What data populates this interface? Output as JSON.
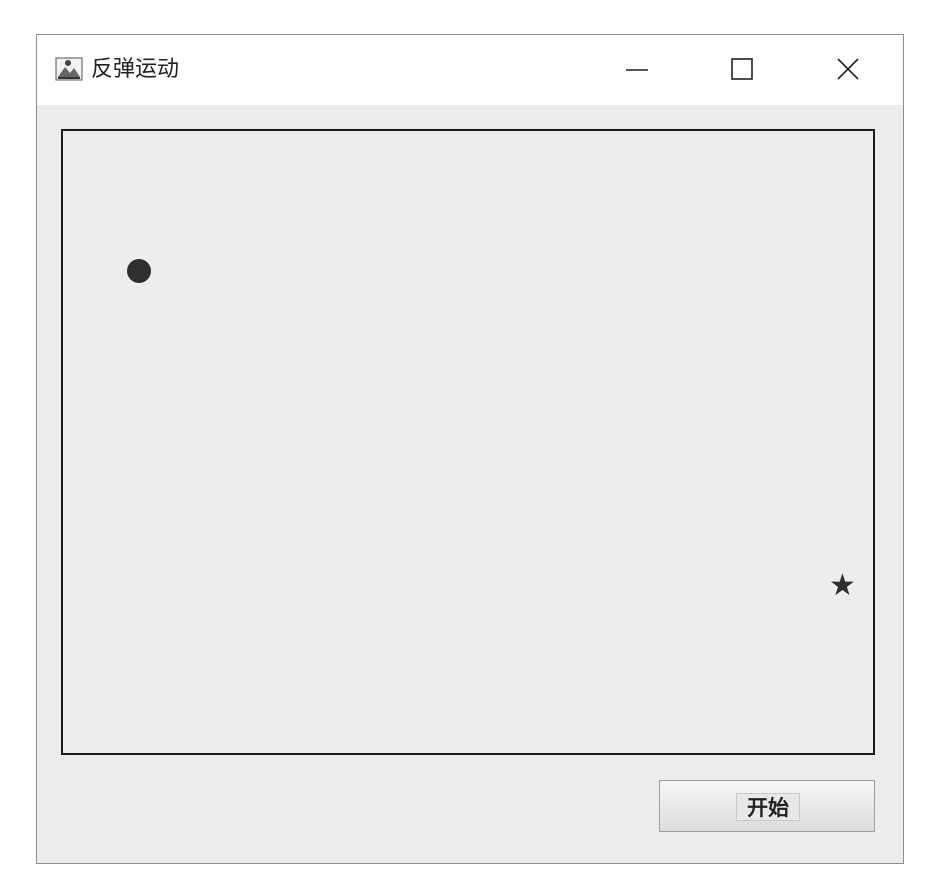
{
  "window": {
    "title": "反弹运动",
    "app_icon": "java-app-icon",
    "controls": [
      "minimize-icon",
      "maximize-icon",
      "close-icon"
    ]
  },
  "canvas": {
    "ball": "ball-icon",
    "star_glyph": "★"
  },
  "footer": {
    "start_label": "开始"
  },
  "colors": {
    "window_bg": "#ececec",
    "titlebar_bg": "#ffffff",
    "canvas_border": "#1a1a1a",
    "sprite": "#2f2f2f"
  }
}
